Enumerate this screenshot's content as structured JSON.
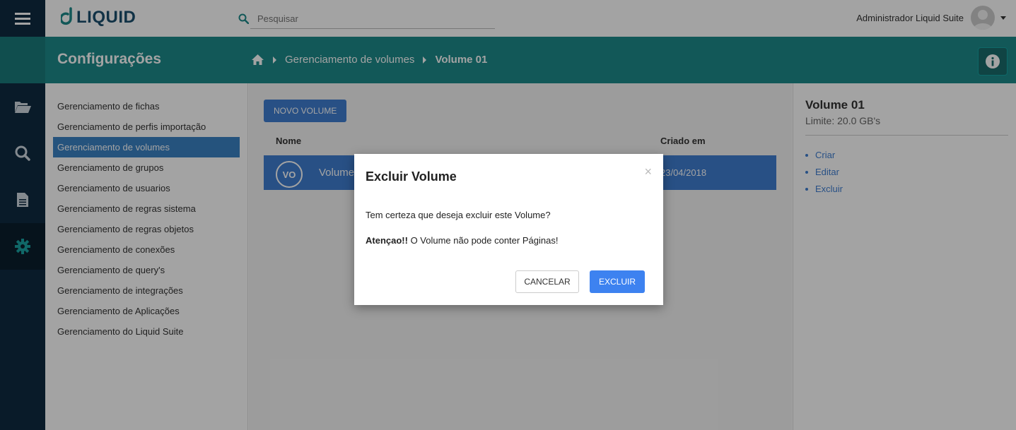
{
  "app": {
    "logo_text": "LIQUID"
  },
  "search": {
    "placeholder": "Pesquisar"
  },
  "user": {
    "name": "Administrador Liquid Suite"
  },
  "header": {
    "title": "Configurações",
    "breadcrumb": [
      "Gerenciamento de volumes",
      "Volume 01"
    ]
  },
  "settings_menu": {
    "items": [
      "Gerenciamento de fichas",
      "Gerenciamento de perfis importação",
      "Gerenciamento de volumes",
      "Gerenciamento de grupos",
      "Gerenciamento de usuarios",
      "Gerenciamento de regras sistema",
      "Gerenciamento de regras objetos",
      "Gerenciamento de conexões",
      "Gerenciamento de query's",
      "Gerenciamento de integrações",
      "Gerenciamento de Aplicações",
      "Gerenciamento do Liquid Suite"
    ],
    "active_index": 2
  },
  "main": {
    "new_button": "NOVO VOLUME",
    "columns": [
      "Nome",
      "Criado em"
    ],
    "rows": [
      {
        "avatar": "VO",
        "name": "Volume 01",
        "created": "23/04/2018"
      }
    ]
  },
  "details": {
    "title": "Volume 01",
    "limit": "Limite: 20.0 GB's",
    "actions": [
      "Criar",
      "Editar",
      "Excluir"
    ]
  },
  "modal": {
    "title": "Excluir Volume",
    "close": "×",
    "question": "Tem certeza que deseja excluir este Volume?",
    "warning_bold": "Atençao!!",
    "warning_text": " O Volume não pode conter Páginas!",
    "cancel": "CANCELAR",
    "confirm": "EXCLUIR"
  },
  "colors": {
    "rail": "#0f2b40",
    "band": "#1d8a8a",
    "accent": "#3f7ed1",
    "confirm": "#3d82f0"
  },
  "icons": [
    "hamburger-icon",
    "search-icon",
    "folder-open-icon",
    "document-icon",
    "gear-icon",
    "home-icon",
    "info-icon",
    "user-avatar-icon"
  ]
}
